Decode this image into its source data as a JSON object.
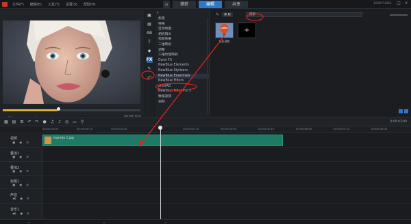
{
  "titlebar": {
    "menu": [
      "文件(F)",
      "编辑(E)",
      "工具(T)",
      "设置(S)",
      "帮助(H)"
    ],
    "tabs": [
      "捕获",
      "编辑",
      "共享"
    ],
    "resolution": "1920*1080"
  },
  "preview": {
    "timecode_left": "00:00:00:00",
    "timecode_right": "00:00:10:0"
  },
  "filter_list": {
    "items": [
      "焦距",
      "特殊",
      "自然绘图",
      "相机镜头",
      "标题效果",
      "二维映射",
      "调整",
      "三维纹理映射",
      "Corel FX",
      "NewBlue Elements",
      "NewBlue Stylizers",
      "NewBlue Essentials",
      "NewBlue Filters",
      "proDAD",
      "NewBlue Filter Pro 5",
      "数据滤镜",
      "视频"
    ],
    "selected_index": 11
  },
  "library": {
    "chip_label": "添加",
    "search_value": "搜索",
    "thumb_caption": "色彩调和"
  },
  "timeline": {
    "timecode": "0:00:03:00",
    "ruler": [
      "00:00:00:00",
      "00:00:00:15",
      "00:00:02:00",
      "00:00:01:15",
      "00:00:04:00",
      "00:00:05:10",
      "00:00:06:00",
      "00:00:07:15",
      "00:00:08:00"
    ],
    "tracks": [
      "视频",
      "叠加1",
      "叠加2",
      "标题1",
      "声音",
      "音乐1"
    ],
    "clip_name": "ingredo 1.jpg"
  },
  "colors": {
    "accent": "#2f78c8",
    "clip": "#1e7a64",
    "annotation": "#e0231e",
    "scrub": "#d8b23a"
  }
}
